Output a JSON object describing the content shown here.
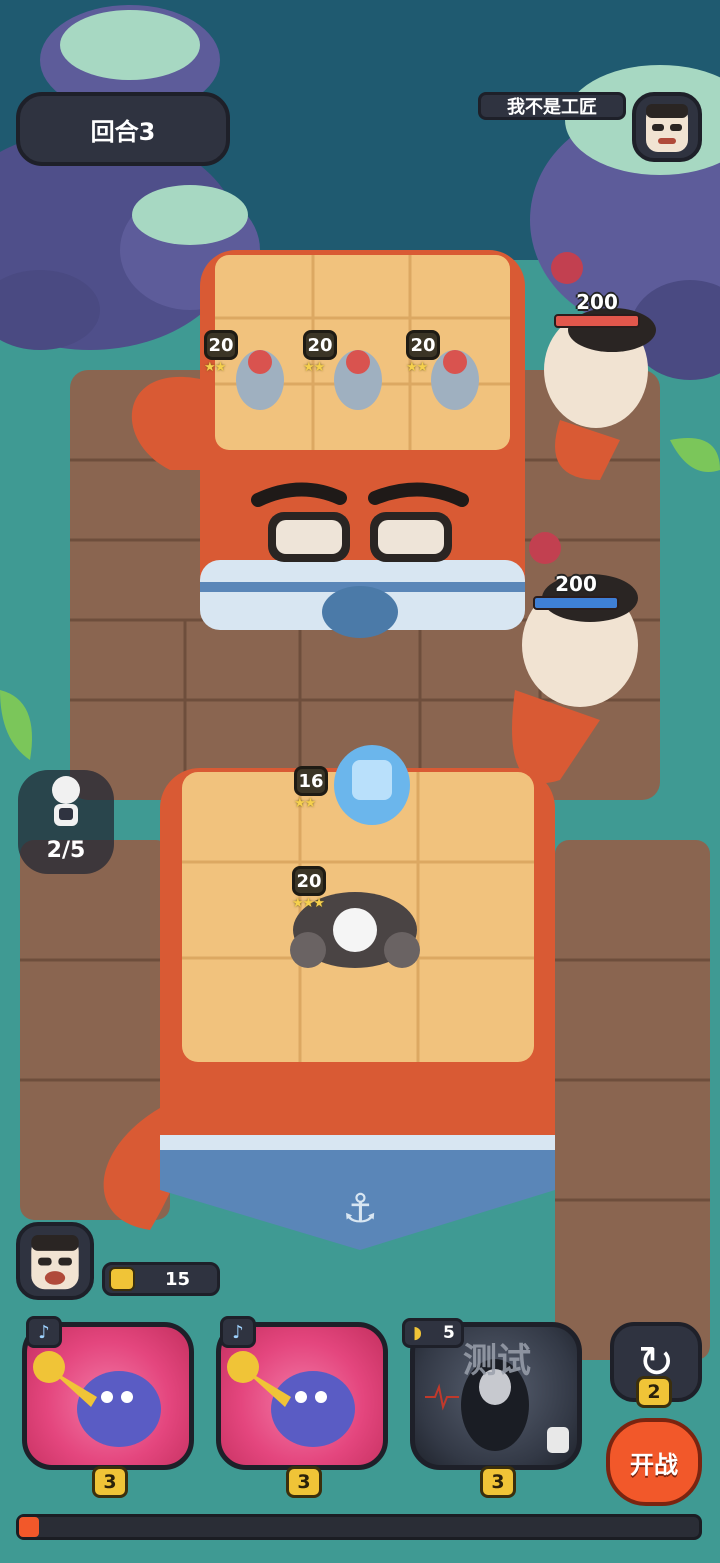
{
  "hud": {
    "round_label": "回合3",
    "opponent_name": "我不是工匠",
    "bench_count": "2/5",
    "coins": "15"
  },
  "enemy_board": {
    "units": [
      {
        "level": "20",
        "stars": "★★"
      },
      {
        "level": "20",
        "stars": "★★"
      },
      {
        "level": "20",
        "stars": "★★"
      }
    ]
  },
  "enemy_guards": [
    {
      "hp": "200",
      "bar_color": "#e2574c"
    },
    {
      "hp": "200",
      "bar_color": "#3f7fd6"
    }
  ],
  "player_board": {
    "units": [
      {
        "level": "16",
        "stars": "★★"
      },
      {
        "level": "20",
        "stars": "★★★"
      }
    ]
  },
  "shop": {
    "cards": [
      {
        "name": "trumpet-blob",
        "cost": "3",
        "tag_icon": "trumpet-icon"
      },
      {
        "name": "trumpet-blob",
        "cost": "3",
        "tag_icon": "trumpet-icon"
      },
      {
        "name": "locked-card",
        "cost": "3",
        "overlay_text": "测试",
        "tag_value": "5",
        "tag_icon": "sound-icon"
      }
    ],
    "refresh_cost": "2",
    "fight_label": "开战",
    "progress_fraction": 0.03
  },
  "colors": {
    "accent_orange": "#f2582a",
    "coin_yellow": "#f0c437",
    "hud_dark": "#2f3340",
    "water": "#3f9a93"
  }
}
